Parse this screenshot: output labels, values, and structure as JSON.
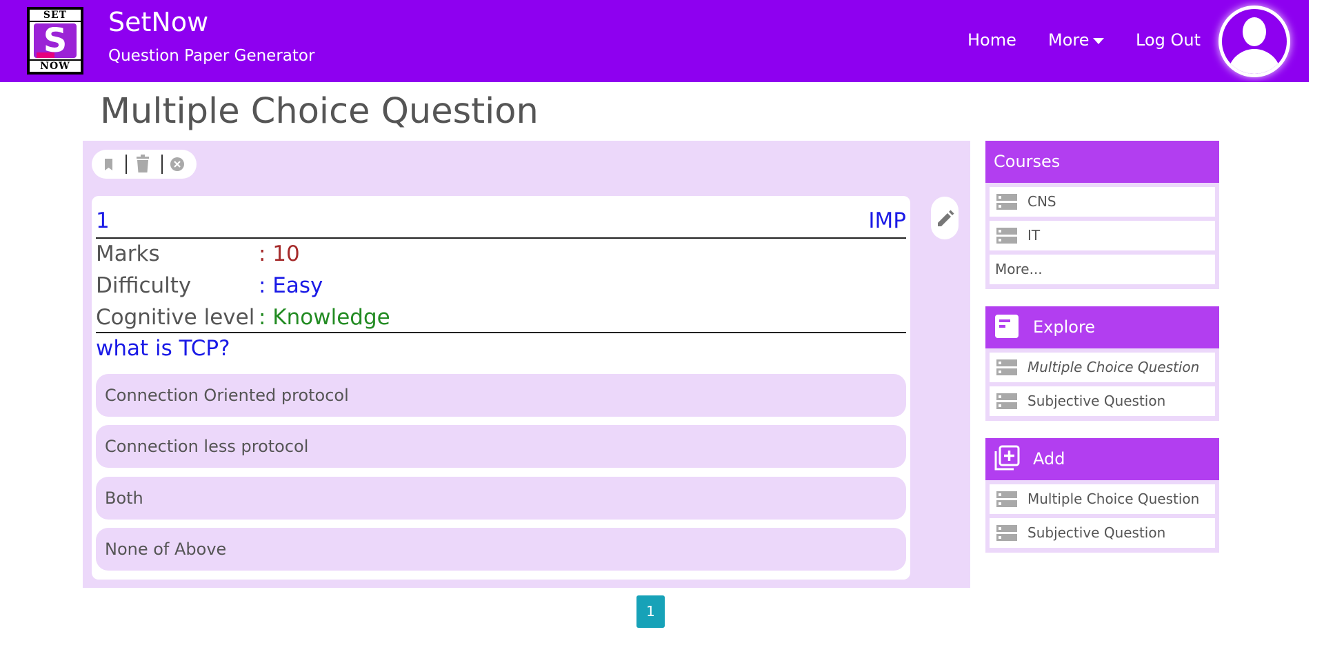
{
  "header": {
    "logo_top": "SET",
    "logo_letter": "S",
    "logo_bottom": "NOW",
    "brand_title": "SetNow",
    "brand_subtitle": "Question Paper Generator",
    "nav": {
      "home": "Home",
      "more": "More",
      "logout": "Log Out"
    },
    "accent_color": "#8e00f0"
  },
  "page_title": "Multiple Choice Question",
  "toolbar": {
    "icons": [
      "bookmark-icon",
      "trash-icon",
      "close-circle-icon"
    ]
  },
  "question": {
    "number": "1",
    "tag": "IMP",
    "marks_label": "Marks",
    "marks_value": ": 10",
    "difficulty_label": "Difficulty",
    "difficulty_value": ": Easy",
    "cognitive_label": "Cognitive level",
    "cognitive_value": ": Knowledge",
    "text": "what is TCP?",
    "options": [
      "Connection Oriented protocol",
      "Connection less protocol",
      "Both",
      "None of Above"
    ]
  },
  "pagination": {
    "current": "1"
  },
  "sidebar": {
    "courses": {
      "title": "Courses",
      "items": [
        "CNS",
        "IT"
      ],
      "more": "More..."
    },
    "explore": {
      "title": "Explore",
      "items": [
        "Multiple Choice Question",
        "Subjective Question"
      ]
    },
    "add": {
      "title": "Add",
      "items": [
        "Multiple Choice Question",
        "Subjective Question"
      ]
    }
  },
  "colors": {
    "panel_bg": "#ecd8fa",
    "sidebar_header": "#b23ef0",
    "pagination": "#17a2b8"
  }
}
